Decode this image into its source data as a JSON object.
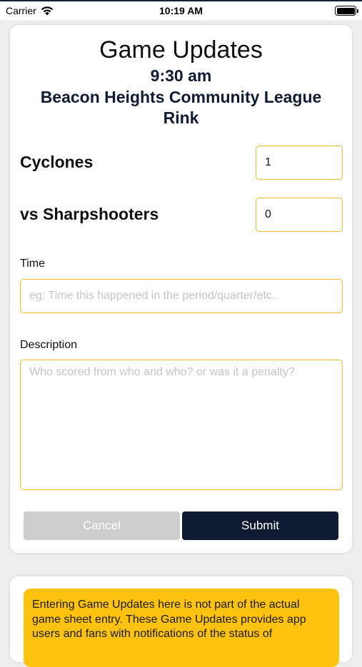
{
  "status_bar": {
    "carrier": "Carrier",
    "time": "10:19 AM",
    "battery_level": 1.0
  },
  "game_update_form": {
    "title": "Game Updates",
    "time": "9:30 am",
    "venue": "Beacon Heights Community League Rink",
    "home_team": {
      "label": "Cyclones",
      "score": "1"
    },
    "away_team": {
      "label": "vs Sharpshooters",
      "score": "0"
    },
    "time_field": {
      "label": "Time",
      "placeholder": "eg: Time this happened in the period/quarter/etc.."
    },
    "description_field": {
      "label": "Description",
      "placeholder": "Who scored from who and who? or was it a penalty?"
    },
    "cancel_label": "Cancel",
    "submit_label": "Submit"
  },
  "notice": {
    "text": "Entering Game Updates here is not part of the actual game sheet entry. These Game Updates provides app users and fans with notifications of the status of"
  },
  "colors": {
    "accent_border": "#f2b92a",
    "navy": "#0f1b33",
    "notice_bg": "#ffc20e",
    "cancel_bg": "#cdcdcd"
  }
}
